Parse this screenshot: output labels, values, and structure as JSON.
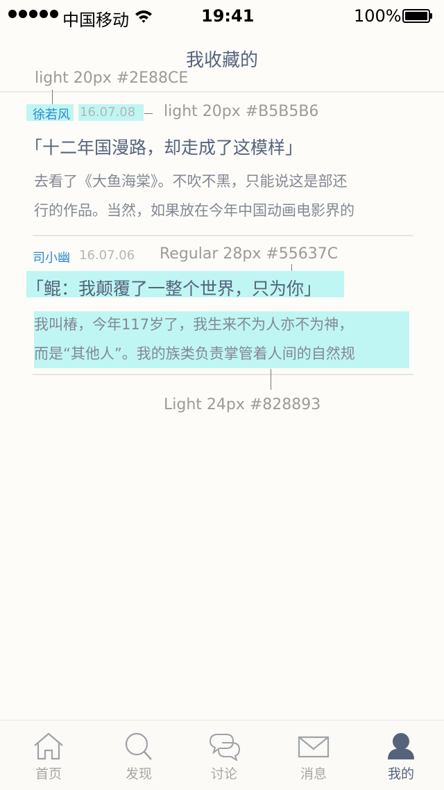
{
  "status_bar": {
    "carrier": "中国移动",
    "time": "19:41",
    "battery": "100%"
  },
  "nav": {
    "title": "我收藏的"
  },
  "annotations": {
    "author_spec": "light 20px #2E88CE",
    "date_spec": "light 20px #B5B5B6",
    "title_spec": "Regular 28px #55637C",
    "body_spec": "Light 24px #828893"
  },
  "articles": [
    {
      "author": "徐若风",
      "date": "16.07.08",
      "title": "「十二年国漫路，却走成了这模样」",
      "body_line1": "去看了《大鱼海棠》。不吹不黑，只能说这是部还",
      "body_line2": "行的作品。当然，如果放在今年中国动画电影界的"
    },
    {
      "author": "司小幽",
      "date": "16.07.06",
      "title": "「鲲：我颠覆了一整个世界，只为你」",
      "body_line1": "我叫椿，今年117岁了，我生来不为人亦不为神，",
      "body_line2": "而是“其他人”。我的族类负责掌管着人间的自然规"
    }
  ],
  "tabbar": {
    "tabs": [
      {
        "label": "首页",
        "icon": "home-icon"
      },
      {
        "label": "发现",
        "icon": "search-icon"
      },
      {
        "label": "讨论",
        "icon": "chat-icon"
      },
      {
        "label": "消息",
        "icon": "mail-icon"
      },
      {
        "label": "我的",
        "icon": "user-icon",
        "active": true
      }
    ]
  },
  "colors": {
    "author": "#2E88CE",
    "date": "#B5B5B6",
    "title": "#55637C",
    "body": "#828893",
    "highlight": "#BFF6F3"
  }
}
